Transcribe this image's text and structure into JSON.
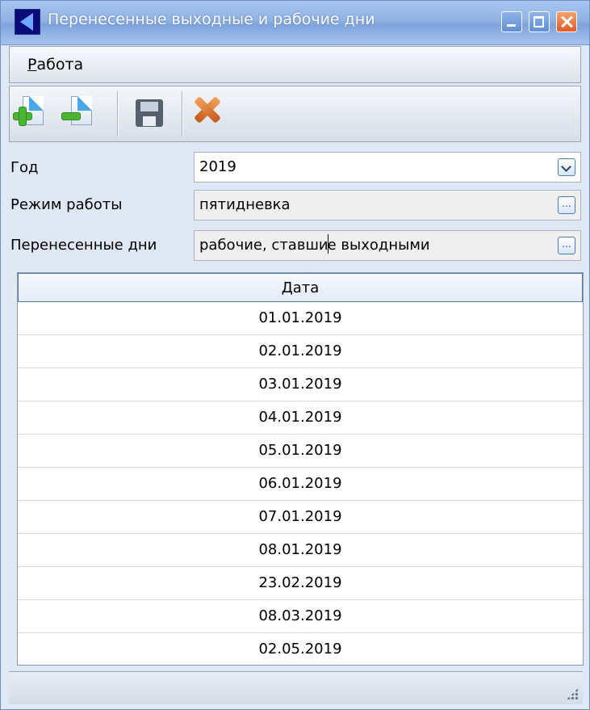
{
  "window": {
    "title": "Перенесенные выходные и рабочие дни"
  },
  "menu": {
    "items": [
      {
        "label_first": "Р",
        "label_rest": "абота"
      }
    ]
  },
  "toolbar": {
    "buttons": [
      "add-document-icon",
      "remove-document-icon",
      "save-icon",
      "cancel-icon"
    ]
  },
  "form": {
    "year_label": "Год",
    "year_value": "2019",
    "mode_label": "Режим работы",
    "mode_value": "пятидневка",
    "moved_label": "Перенесенные дни",
    "moved_value_a": "рабочие, ставши",
    "moved_value_b": "е выходными",
    "ellipsis": "..."
  },
  "grid": {
    "header": "Дата",
    "rows": [
      "01.01.2019",
      "02.01.2019",
      "03.01.2019",
      "04.01.2019",
      "05.01.2019",
      "06.01.2019",
      "07.01.2019",
      "08.01.2019",
      "23.02.2019",
      "08.03.2019",
      "02.05.2019"
    ]
  }
}
